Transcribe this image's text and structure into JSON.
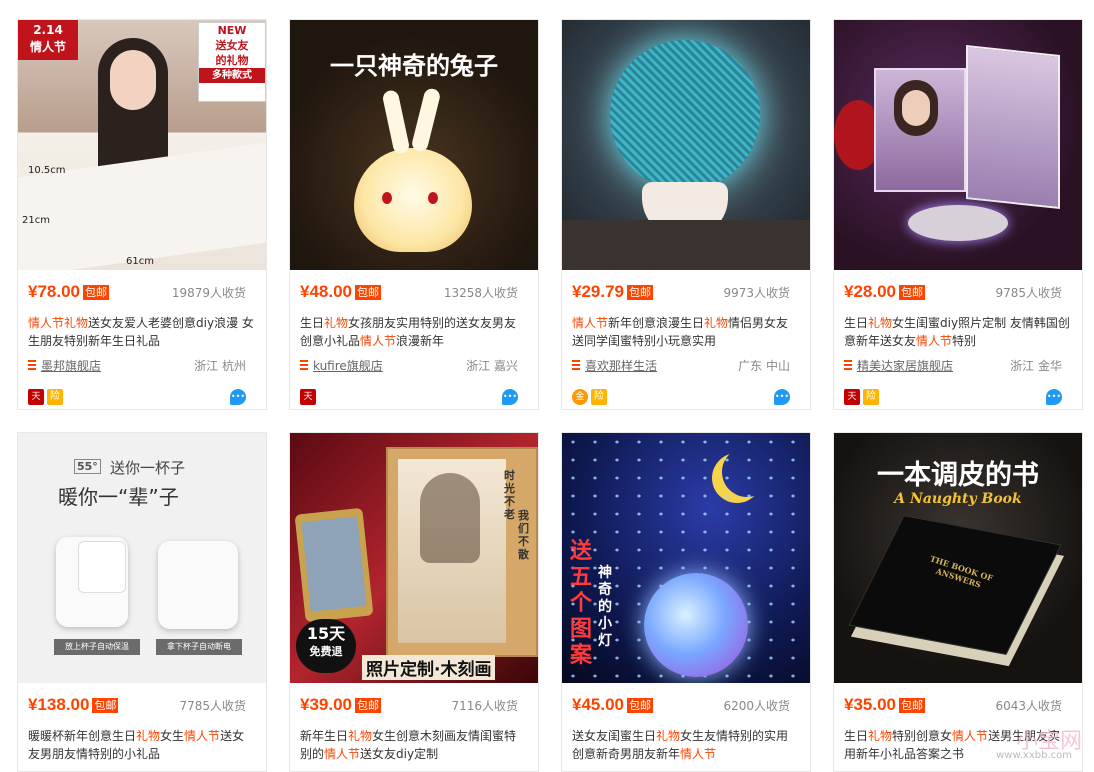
{
  "products": [
    {
      "overlay": [
        "2.14",
        "情人节",
        "NEW",
        "送女友",
        "的礼物",
        "多种款式",
        "10.5cm",
        "21cm",
        "61cm"
      ],
      "price": "¥78.00",
      "badge": "包邮",
      "sales": "19879人收货",
      "title": [
        {
          "t": "情人节礼物",
          "h": true
        },
        {
          "t": "送女友爱人老婆创意diy浪漫 女生朋友特别新年生日礼品",
          "h": false
        }
      ],
      "shop": "墨邦旗舰店",
      "location": "浙江 杭州",
      "icons": [
        "tmall-icon",
        "insurance-icon"
      ]
    },
    {
      "overlay": [
        "一只神奇的兔子"
      ],
      "price": "¥48.00",
      "badge": "包邮",
      "sales": "13258人收货",
      "title": [
        {
          "t": "生日",
          "h": false
        },
        {
          "t": "礼物",
          "h": true
        },
        {
          "t": "女孩朋友实用特别的送女友男友创意小礼品",
          "h": false
        },
        {
          "t": "情人节",
          "h": true
        },
        {
          "t": "浪漫新年",
          "h": false
        }
      ],
      "shop": "kufire旗舰店",
      "location": "浙江 嘉兴",
      "icons": [
        "tmall-icon"
      ]
    },
    {
      "overlay": [],
      "price": "¥29.79",
      "badge": "包邮",
      "sales": "9973人收货",
      "title": [
        {
          "t": "情人节",
          "h": true
        },
        {
          "t": "新年创意浪漫生日",
          "h": false
        },
        {
          "t": "礼物",
          "h": true
        },
        {
          "t": "情侣男女友送同学闺蜜特别小玩意实用",
          "h": false
        }
      ],
      "shop": "喜欢那样生活",
      "location": "广东 中山",
      "icons": [
        "gold-seller-icon",
        "insurance-icon"
      ]
    },
    {
      "overlay": [],
      "price": "¥28.00",
      "badge": "包邮",
      "sales": "9785人收货",
      "title": [
        {
          "t": "生日",
          "h": false
        },
        {
          "t": "礼物",
          "h": true
        },
        {
          "t": "女生闺蜜diy照片定制 友情韩国创意新年送女友",
          "h": false
        },
        {
          "t": "情人节",
          "h": true
        },
        {
          "t": "特别",
          "h": false
        }
      ],
      "shop": "精美达家居旗舰店",
      "location": "浙江 金华",
      "icons": [
        "tmall-icon",
        "insurance-icon"
      ]
    },
    {
      "overlay": [
        "55°",
        "送你一杯子",
        "暖你一“辈”子",
        "放上杯子自动保温",
        "拿下杯子自动断电"
      ],
      "price": "¥138.00",
      "badge": "包邮",
      "sales": "7785人收货",
      "title": [
        {
          "t": "暖暖杯新年创意生日",
          "h": false
        },
        {
          "t": "礼物",
          "h": true
        },
        {
          "t": "女生",
          "h": false
        },
        {
          "t": "情人节",
          "h": true
        },
        {
          "t": "送女友男朋友情特别的小礼品",
          "h": false
        }
      ]
    },
    {
      "overlay": [
        "时光不老",
        "我们不散",
        "15天",
        "免费退",
        "照片定制·木刻画"
      ],
      "price": "¥39.00",
      "badge": "包邮",
      "sales": "7116人收货",
      "title": [
        {
          "t": "新年生日",
          "h": false
        },
        {
          "t": "礼物",
          "h": true
        },
        {
          "t": "女生创意木刻画友情闺蜜特别的",
          "h": false
        },
        {
          "t": "情人节",
          "h": true
        },
        {
          "t": "送女友diy定制",
          "h": false
        }
      ]
    },
    {
      "overlay": [
        "送",
        "五个",
        "图案",
        "神奇的小灯"
      ],
      "price": "¥45.00",
      "badge": "包邮",
      "sales": "6200人收货",
      "title": [
        {
          "t": "送女友闺蜜生日",
          "h": false
        },
        {
          "t": "礼物",
          "h": true
        },
        {
          "t": "女生友情特别的实用创意新奇男朋友新年",
          "h": false
        },
        {
          "t": "情人节",
          "h": true
        }
      ]
    },
    {
      "overlay": [
        "一本调皮的书",
        "A Naughty Book",
        "THE BOOK OF ANSWERS"
      ],
      "price": "¥35.00",
      "badge": "包邮",
      "sales": "6043人收货",
      "title": [
        {
          "t": "生日",
          "h": false
        },
        {
          "t": "礼物",
          "h": true
        },
        {
          "t": "特别创意女",
          "h": false
        },
        {
          "t": "情人节",
          "h": true
        },
        {
          "t": "送男生朋友实用新年小礼品答案之书",
          "h": false
        }
      ]
    }
  ],
  "watermark": "小宝网",
  "watermark_sub": "www.xxbb.com"
}
